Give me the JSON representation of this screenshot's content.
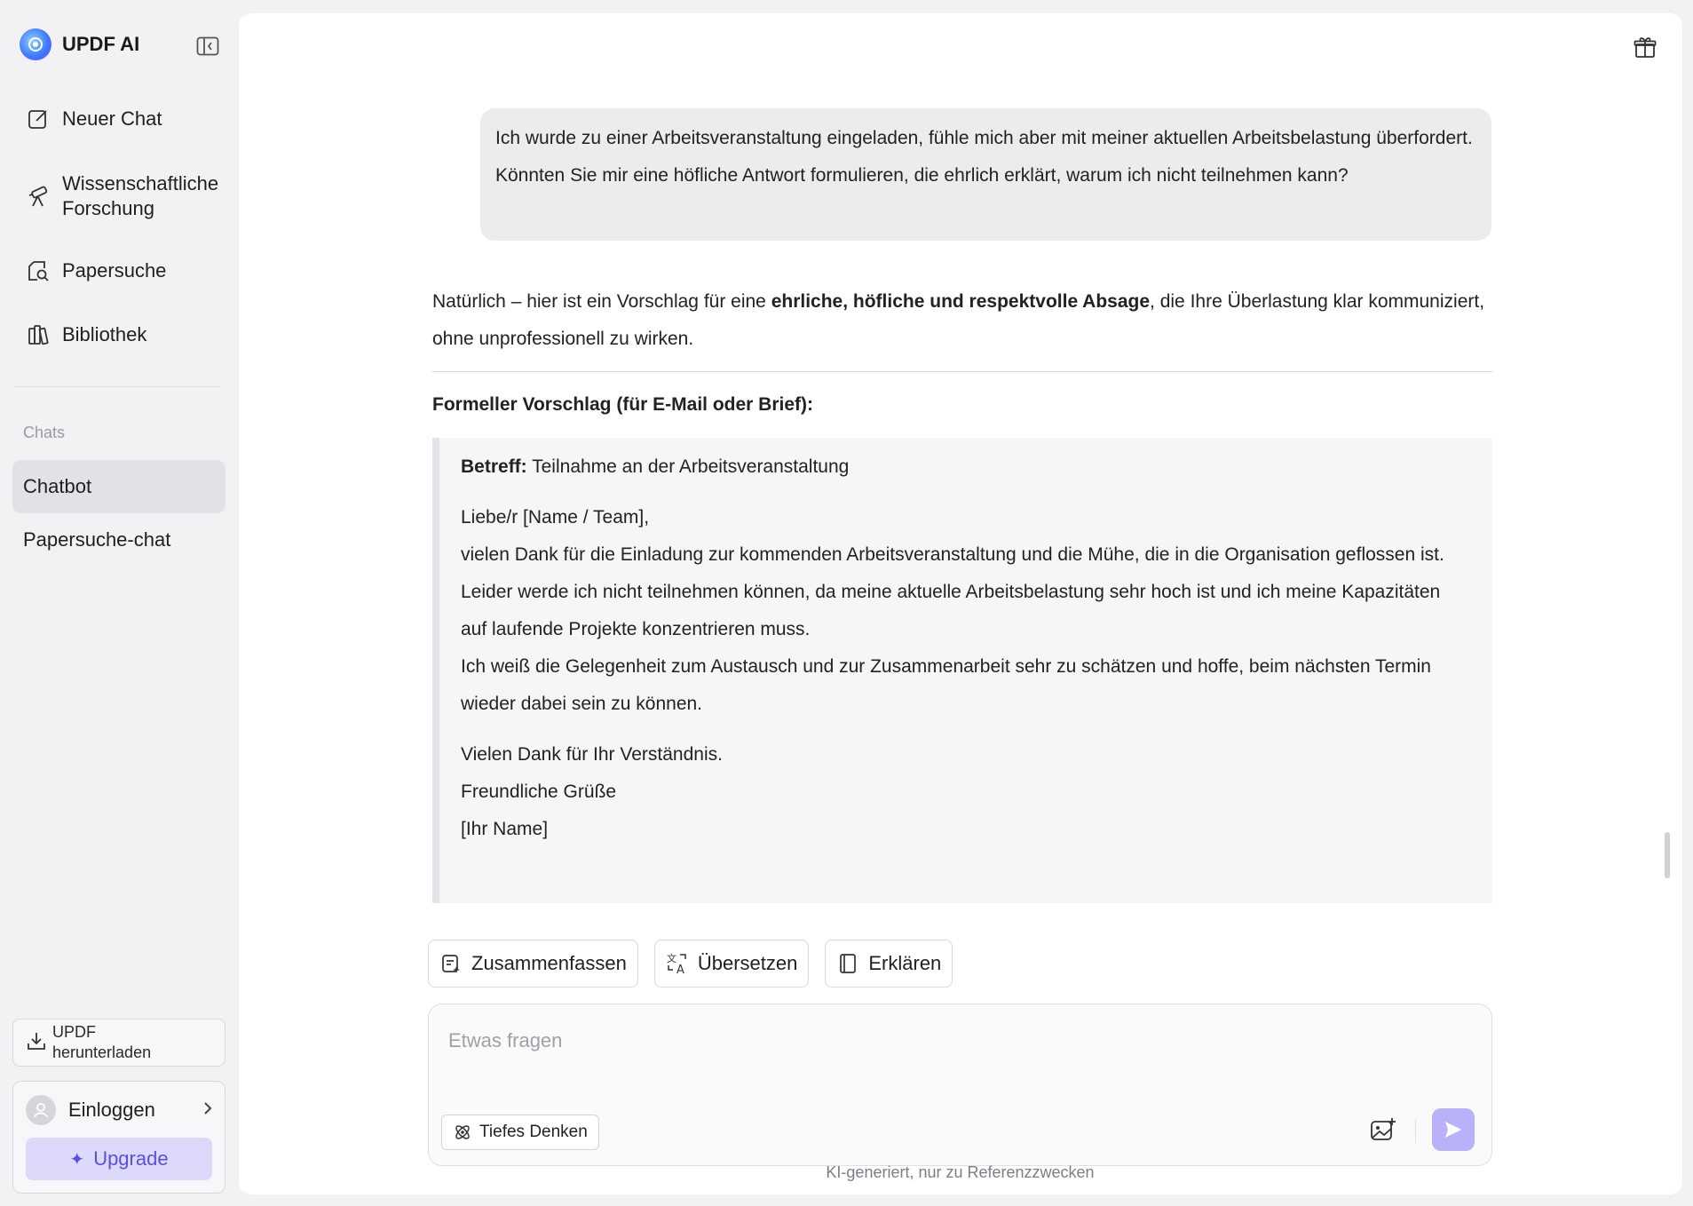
{
  "app": {
    "name": "UPDF AI"
  },
  "sidebar": {
    "nav": [
      {
        "label": "Neuer Chat",
        "icon": "edit-icon"
      },
      {
        "label": "Wissenschaftliche Forschung",
        "icon": "telescope-icon"
      },
      {
        "label": "Papersuche",
        "icon": "document-search-icon"
      },
      {
        "label": "Bibliothek",
        "icon": "library-icon"
      }
    ],
    "section_label": "Chats",
    "chats": [
      {
        "label": "Chatbot",
        "active": true
      },
      {
        "label": "Papersuche-chat",
        "active": false
      }
    ],
    "download_label_line1": "UPDF",
    "download_label_line2": "herunterladen",
    "login_label": "Einloggen",
    "upgrade_label": "Upgrade"
  },
  "conversation": {
    "user_message": "Ich wurde zu einer Arbeitsveranstaltung eingeladen, fühle mich aber mit meiner aktuellen Arbeitsbelastung überfordert. Könnten Sie mir eine höfliche Antwort formulieren, die ehrlich erklärt, warum ich nicht teilnehmen kann?",
    "intro_before": "Natürlich – hier ist ein Vorschlag für eine ",
    "intro_bold": "ehrliche, höfliche und respektvolle Absage",
    "intro_after": ", die Ihre Überlastung klar kommuniziert, ohne unprofessionell zu wirken.",
    "heading": "Formeller Vorschlag (für E-Mail oder Brief):",
    "subject_label": "Betreff:",
    "subject_text": " Teilnahme an der Arbeitsveranstaltung",
    "greeting": "Liebe/r [Name / Team],",
    "body_1": "vielen Dank für die Einladung zur kommenden Arbeitsveranstaltung und die Mühe, die in die Organisation geflossen ist.",
    "body_2": "Leider werde ich nicht teilnehmen können, da meine aktuelle Arbeitsbelastung sehr hoch ist und ich meine Kapazitäten auf laufende Projekte konzentrieren muss.",
    "body_3": "Ich weiß die Gelegenheit zum Austausch und zur Zusammenarbeit sehr zu schätzen und hoffe, beim nächsten Termin wieder dabei sein zu können.",
    "closing_1": "Vielen Dank für Ihr Verständnis.",
    "closing_2": "Freundliche Grüße",
    "closing_3": "[Ihr Name]"
  },
  "actions": [
    {
      "label": "Zusammenfassen",
      "icon": "summarize-icon"
    },
    {
      "label": "Übersetzen",
      "icon": "translate-icon"
    },
    {
      "label": "Erklären",
      "icon": "book-icon"
    }
  ],
  "composer": {
    "placeholder": "Etwas fragen",
    "deep_think_label": "Tiefes Denken"
  },
  "disclaimer": "KI-generiert, nur zu Referenzzwecken",
  "colors": {
    "accent": "#5a4fe0",
    "upgrade_bg": "#dcd9fb",
    "send_bg": "#b9b2fb",
    "active_chat_bg": "#e2e2e6"
  }
}
